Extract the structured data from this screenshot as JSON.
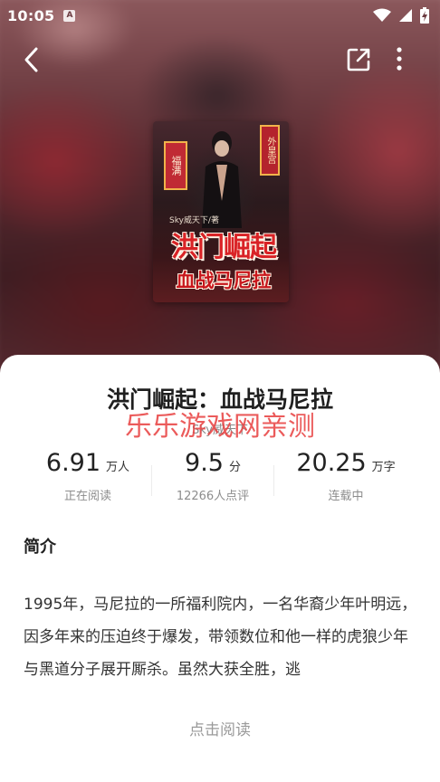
{
  "status_bar": {
    "time": "10:05",
    "notification_icon": "a-badge-icon",
    "icons": [
      "wifi-icon",
      "signal-icon",
      "battery-charging-icon"
    ]
  },
  "top_bar": {
    "back_icon": "chevron-left-icon",
    "share_icon": "share-external-icon",
    "more_icon": "more-vertical-icon"
  },
  "cover": {
    "author_line": "Sky威天下/著",
    "title_line1": "洪门崛起",
    "title_line2": "血战马尼拉",
    "sign_left": "福满",
    "sign_right": "外皇宫"
  },
  "book": {
    "title": "洪门崛起：血战马尼拉",
    "author": "Sky威天下"
  },
  "watermark": "乐乐游戏网亲测",
  "stats": [
    {
      "value": "6.91",
      "unit": "万人",
      "label": "正在阅读"
    },
    {
      "value": "9.5",
      "unit": "分",
      "label": "12266人点评"
    },
    {
      "value": "20.25",
      "unit": "万字",
      "label": "连载中"
    }
  ],
  "intro": {
    "heading": "简介",
    "text": "1995年，马尼拉的一所福利院内，一名华裔少年叶明远，因多年来的压迫终于爆发，带领数位和他一样的虎狼少年与黑道分子展开厮杀。虽然大获全胜，逃"
  },
  "read_button": "点击阅读",
  "colors": {
    "watermark": "#e83e3e",
    "title": "#1f1f1f",
    "muted": "#8d8d8d"
  }
}
